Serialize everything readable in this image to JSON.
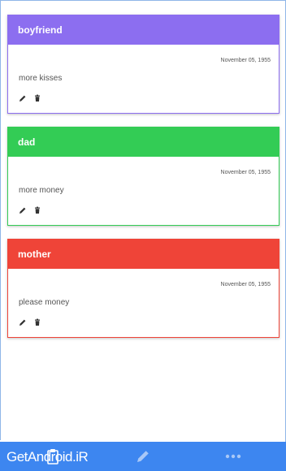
{
  "cards": [
    {
      "title": "boyfriend",
      "date": "November 05, 1955",
      "text": "more kisses",
      "color": "#8c6ef0"
    },
    {
      "title": "dad",
      "date": "November 05, 1955",
      "text": "more money",
      "color": "#33cc55"
    },
    {
      "title": "mother",
      "date": "November 05, 1955",
      "text": "please money",
      "color": "#ef4438"
    }
  ],
  "icons": {
    "edit": "pencil-icon",
    "delete": "trash-icon",
    "tab_notes": "clipboard-icon",
    "tab_compose": "pencil-icon",
    "tab_more": "more-dots-icon"
  },
  "bottom_bar": {
    "color": "#3d86f0",
    "watermark": "GetAndroid.iR"
  }
}
